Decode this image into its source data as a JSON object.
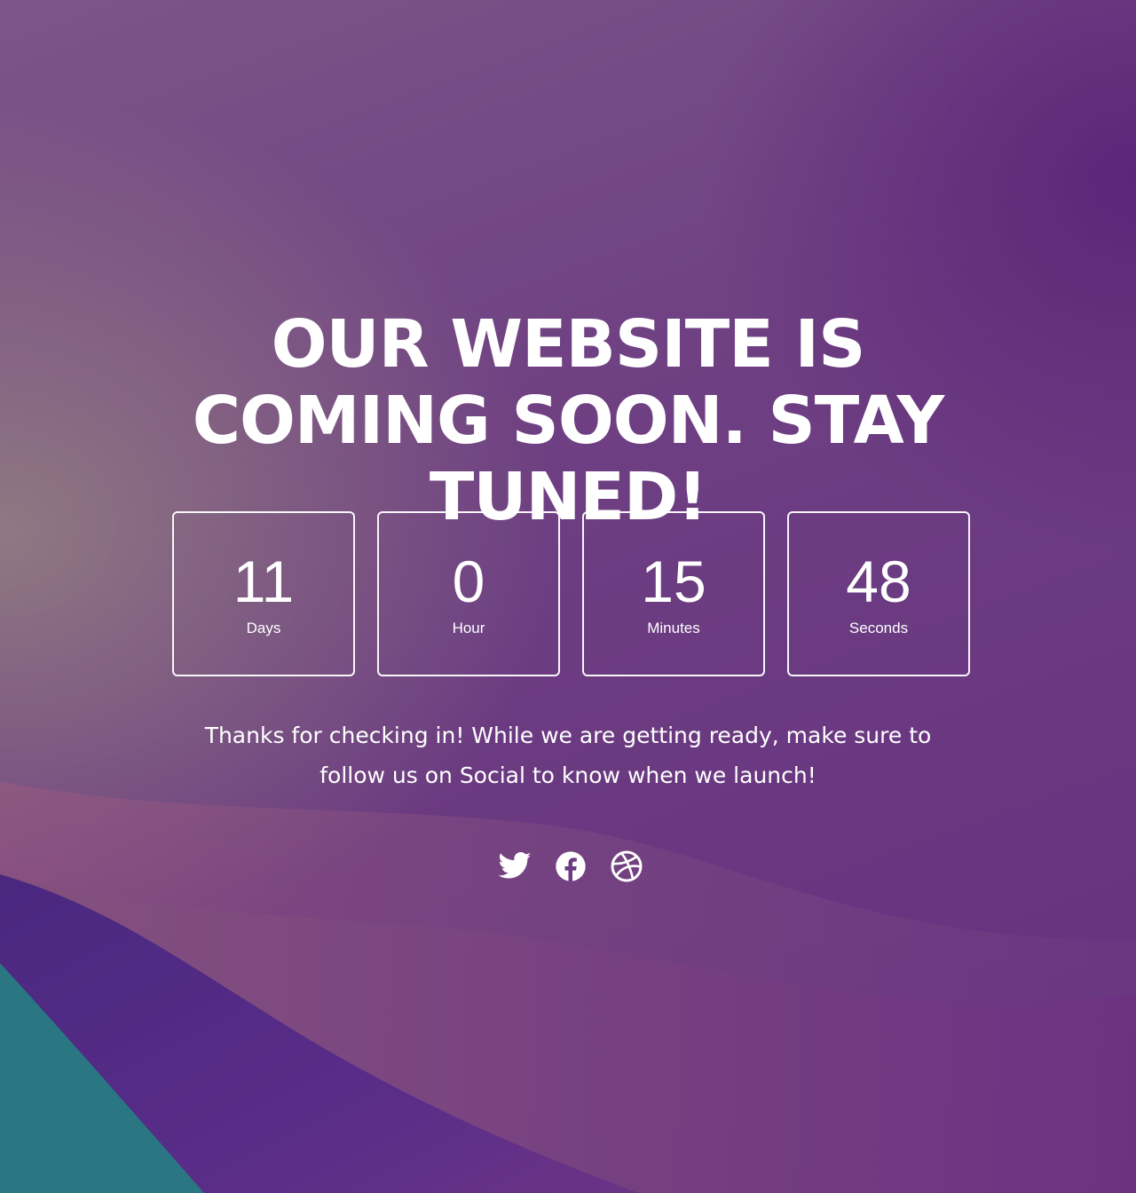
{
  "hero": {
    "headline": "OUR WEBSITE IS COMING SOON. STAY TUNED!"
  },
  "countdown": [
    {
      "value": "11",
      "label": "Days"
    },
    {
      "value": "0",
      "label": "Hour"
    },
    {
      "value": "15",
      "label": "Minutes"
    },
    {
      "value": "48",
      "label": "Seconds"
    }
  ],
  "message": "Thanks for checking in! While we are getting ready, make sure to follow us on Social to know when we launch!",
  "social": [
    {
      "icon": "twitter-icon"
    },
    {
      "icon": "facebook-icon"
    },
    {
      "icon": "dribbble-icon"
    }
  ],
  "colors": {
    "background": "#6a3a82",
    "text": "#ffffff",
    "wave_pink": "#a35a7e",
    "wave_purple": "#4e2a86",
    "wave_teal": "#2a7a85"
  }
}
